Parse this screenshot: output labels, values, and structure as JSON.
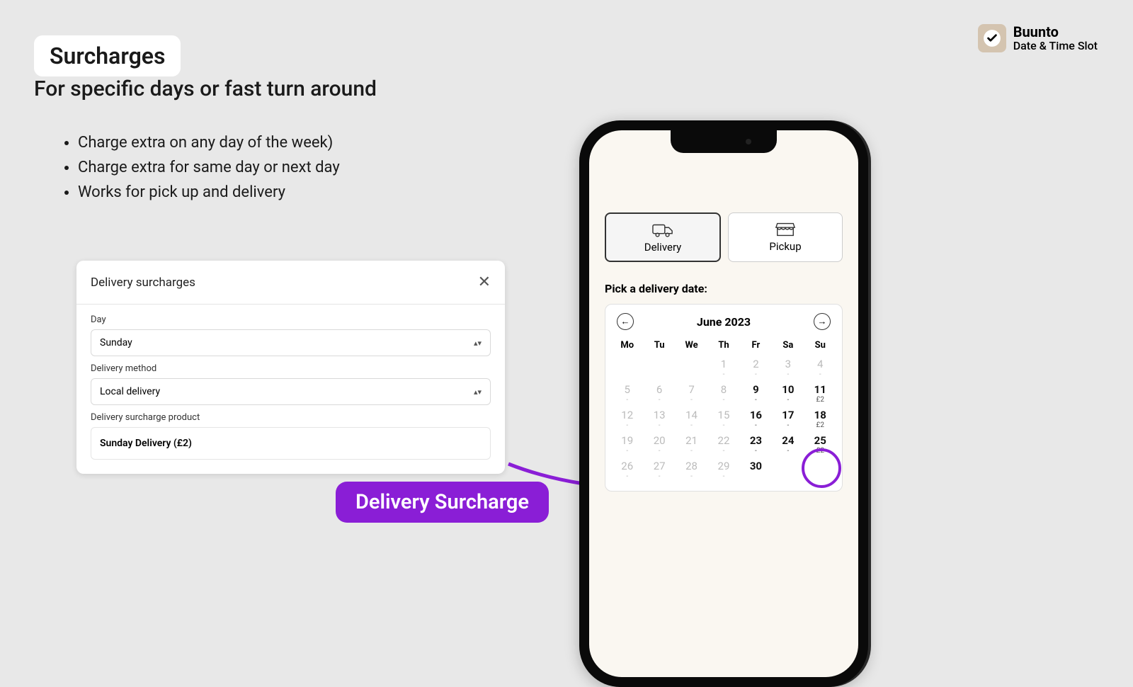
{
  "title_badge": "Surcharges",
  "subtitle": "For specific days or fast turn around",
  "bullets": [
    "Charge extra on any day of the week)",
    "Charge extra for same day or next day",
    "Works for pick up and delivery"
  ],
  "brand": {
    "name": "Buunto",
    "sub": "Date & Time Slot"
  },
  "modal": {
    "title": "Delivery surcharges",
    "day_label": "Day",
    "day_value": "Sunday",
    "method_label": "Delivery method",
    "method_value": "Local delivery",
    "product_label": "Delivery surcharge product",
    "product_value": "Sunday Delivery (£2)"
  },
  "pill": "Delivery Surcharge",
  "phone": {
    "tab_delivery": "Delivery",
    "tab_pickup": "Pickup",
    "pick_label": "Pick a delivery date:",
    "month": "June 2023",
    "dows": [
      "Mo",
      "Tu",
      "We",
      "Th",
      "Fr",
      "Sa",
      "Su"
    ],
    "days": [
      {
        "n": "",
        "s": "",
        "a": false
      },
      {
        "n": "",
        "s": "",
        "a": false
      },
      {
        "n": "",
        "s": "",
        "a": false
      },
      {
        "n": "1",
        "s": "-",
        "a": false
      },
      {
        "n": "2",
        "s": "-",
        "a": false
      },
      {
        "n": "3",
        "s": "-",
        "a": false
      },
      {
        "n": "4",
        "s": "-",
        "a": false
      },
      {
        "n": "5",
        "s": "-",
        "a": false
      },
      {
        "n": "6",
        "s": "-",
        "a": false
      },
      {
        "n": "7",
        "s": "-",
        "a": false
      },
      {
        "n": "8",
        "s": "-",
        "a": false
      },
      {
        "n": "9",
        "s": "-",
        "a": true
      },
      {
        "n": "10",
        "s": "-",
        "a": true
      },
      {
        "n": "11",
        "s": "£2",
        "a": true
      },
      {
        "n": "12",
        "s": "-",
        "a": false
      },
      {
        "n": "13",
        "s": "-",
        "a": false
      },
      {
        "n": "14",
        "s": "-",
        "a": false
      },
      {
        "n": "15",
        "s": "-",
        "a": false
      },
      {
        "n": "16",
        "s": "-",
        "a": true
      },
      {
        "n": "17",
        "s": "-",
        "a": true
      },
      {
        "n": "18",
        "s": "£2",
        "a": true
      },
      {
        "n": "19",
        "s": "-",
        "a": false
      },
      {
        "n": "20",
        "s": "-",
        "a": false
      },
      {
        "n": "21",
        "s": "-",
        "a": false
      },
      {
        "n": "22",
        "s": "-",
        "a": false
      },
      {
        "n": "23",
        "s": "-",
        "a": true
      },
      {
        "n": "24",
        "s": "-",
        "a": true
      },
      {
        "n": "25",
        "s": "£2",
        "a": true
      },
      {
        "n": "26",
        "s": "-",
        "a": false
      },
      {
        "n": "27",
        "s": "-",
        "a": false
      },
      {
        "n": "28",
        "s": "-",
        "a": false
      },
      {
        "n": "29",
        "s": "-",
        "a": false
      },
      {
        "n": "30",
        "s": "",
        "a": true
      },
      {
        "n": "",
        "s": "",
        "a": false
      },
      {
        "n": "",
        "s": "",
        "a": false
      }
    ]
  }
}
